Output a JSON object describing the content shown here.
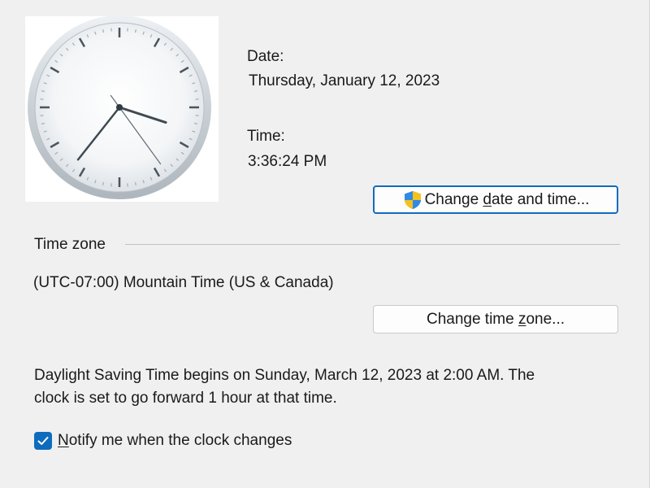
{
  "date": {
    "label": "Date:",
    "value": "Thursday, January 12, 2023"
  },
  "time": {
    "label": "Time:",
    "value": "3:36:24 PM"
  },
  "buttons": {
    "change_date_time": {
      "before": "Change ",
      "mnemonic": "d",
      "after": "ate and time..."
    },
    "change_time_zone": {
      "before": "Change time ",
      "mnemonic": "z",
      "after": "one..."
    }
  },
  "time_zone": {
    "heading": "Time zone",
    "value": "(UTC-07:00) Mountain Time (US & Canada)"
  },
  "dst_info": {
    "line1": "Daylight Saving Time begins on Sunday, March 12, 2023 at 2:00 AM. The",
    "line2": "clock is set to go forward 1 hour at that time."
  },
  "notify": {
    "checked": true,
    "mnemonic": "N",
    "label_rest": "otify me when the clock changes"
  },
  "clock": {
    "hours": 3,
    "minutes": 36,
    "seconds": 24
  },
  "colors": {
    "accent": "#0f6cbd",
    "background": "#f0f0f0"
  },
  "icons": {
    "uac": "shield-icon",
    "check": "checkmark-icon"
  }
}
